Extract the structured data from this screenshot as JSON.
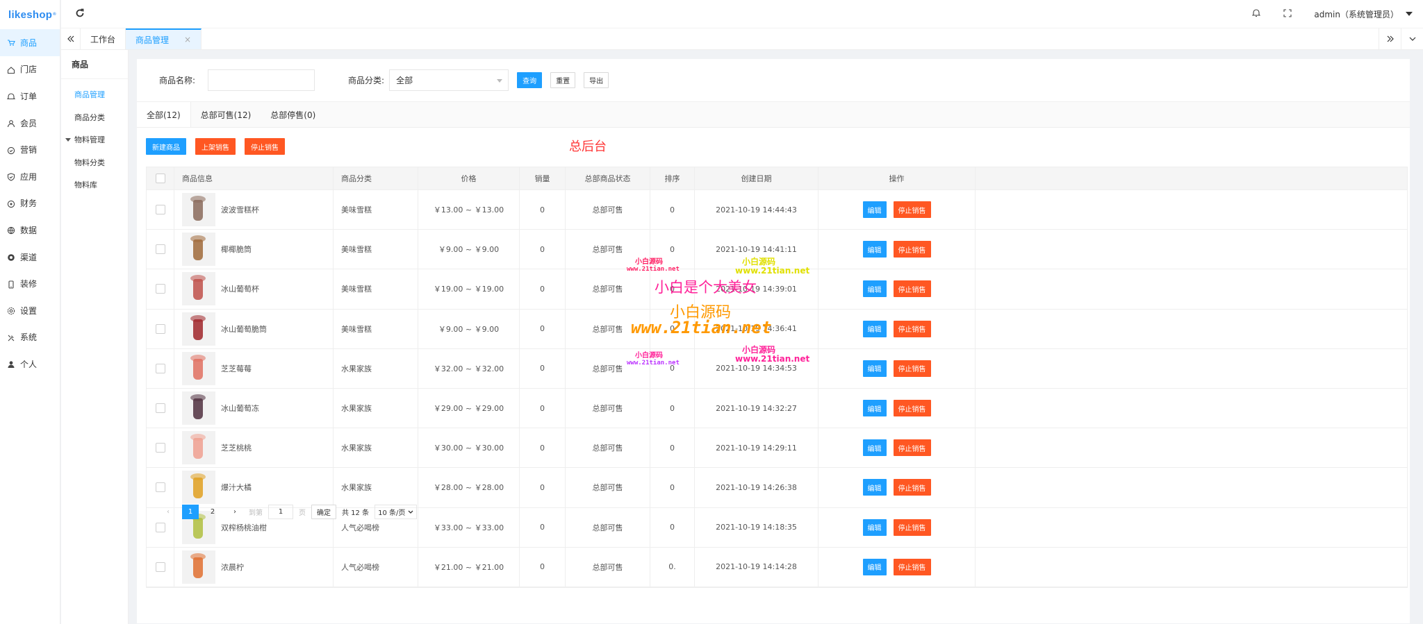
{
  "brand": {
    "logo_text": "likeshop",
    "logo_mark": "®",
    "color": "#2d8cf0"
  },
  "sidebar": {
    "items": [
      {
        "label": "商品",
        "icon": "cart-icon",
        "active": true
      },
      {
        "label": "门店",
        "icon": "home-icon"
      },
      {
        "label": "订单",
        "icon": "bell-icon"
      },
      {
        "label": "会员",
        "icon": "user-icon"
      },
      {
        "label": "营销",
        "icon": "heart-icon"
      },
      {
        "label": "应用",
        "icon": "shield-icon"
      },
      {
        "label": "财务",
        "icon": "coin-icon"
      },
      {
        "label": "数据",
        "icon": "globe-icon"
      },
      {
        "label": "渠道",
        "icon": "channel-icon"
      },
      {
        "label": "装修",
        "icon": "mobile-icon"
      },
      {
        "label": "设置",
        "icon": "gear-icon"
      },
      {
        "label": "系统",
        "icon": "tools-icon"
      },
      {
        "label": "个人",
        "icon": "person-icon"
      }
    ]
  },
  "topbar": {
    "user": "admin（系统管理员）"
  },
  "tabs": [
    {
      "label": "工作台"
    },
    {
      "label": "商品管理",
      "close": "×"
    }
  ],
  "subnav": {
    "title": "商品",
    "items": [
      {
        "label": "商品管理",
        "active": true
      },
      {
        "label": "商品分类"
      },
      {
        "label": "物料管理",
        "group": true
      },
      {
        "label": "物料分类"
      },
      {
        "label": "物料库"
      }
    ]
  },
  "filter": {
    "name_label": "商品名称:",
    "name_value": "",
    "category_label": "商品分类:",
    "category_value": "全部",
    "query": "查询",
    "reset": "重置",
    "export": "导出"
  },
  "subtabs": [
    {
      "label": "全部(12)"
    },
    {
      "label": "总部可售(12)"
    },
    {
      "label": "总部停售(0)"
    }
  ],
  "actions": {
    "new": "新建商品",
    "on_sale": "上架销售",
    "stop": "停止销售"
  },
  "watermark_title": "总后台",
  "table": {
    "headers": [
      "商品信息",
      "商品分类",
      "价格",
      "销量",
      "总部商品状态",
      "排序",
      "创建日期",
      "操作"
    ],
    "edit_label": "编辑",
    "stop_label": "停止销售",
    "rows": [
      {
        "name": "波波雪糕杯",
        "category": "美味雪糕",
        "price": "￥13.00 ~ ￥13.00",
        "sales": "0",
        "status": "总部可售",
        "sort": "0",
        "date": "2021-10-19 14:44:43",
        "color": "#8a6a5a"
      },
      {
        "name": "椰椰脆筒",
        "category": "美味雪糕",
        "price": "￥9.00 ~ ￥9.00",
        "sales": "0",
        "status": "总部可售",
        "sort": "0",
        "date": "2021-10-19 14:41:11",
        "color": "#a06a3a"
      },
      {
        "name": "冰山葡萄杯",
        "category": "美味雪糕",
        "price": "￥19.00 ~ ￥19.00",
        "sales": "0",
        "status": "总部可售",
        "sort": "0",
        "date": "2021-10-19 14:39:01",
        "color": "#c0504a"
      },
      {
        "name": "冰山葡萄脆筒",
        "category": "美味雪糕",
        "price": "￥9.00 ~ ￥9.00",
        "sales": "0",
        "status": "总部可售",
        "sort": "0",
        "date": "2021-10-19 14:36:41",
        "color": "#a0262a"
      },
      {
        "name": "芝芝莓莓",
        "category": "水果家族",
        "price": "￥32.00 ~ ￥32.00",
        "sales": "0",
        "status": "总部可售",
        "sort": "0",
        "date": "2021-10-19 14:34:53",
        "color": "#e07060"
      },
      {
        "name": "冰山葡萄冻",
        "category": "水果家族",
        "price": "￥29.00 ~ ￥29.00",
        "sales": "0",
        "status": "总部可售",
        "sort": "0",
        "date": "2021-10-19 14:32:27",
        "color": "#503040"
      },
      {
        "name": "芝芝桃桃",
        "category": "水果家族",
        "price": "￥30.00 ~ ￥30.00",
        "sales": "0",
        "status": "总部可售",
        "sort": "0",
        "date": "2021-10-19 14:29:11",
        "color": "#f0a090"
      },
      {
        "name": "爆汁大橘",
        "category": "水果家族",
        "price": "￥28.00 ~ ￥28.00",
        "sales": "0",
        "status": "总部可售",
        "sort": "0",
        "date": "2021-10-19 14:26:38",
        "color": "#e0a020"
      },
      {
        "name": "双榨杨桃油柑",
        "category": "人气必喝榜",
        "price": "￥33.00 ~ ￥33.00",
        "sales": "0",
        "status": "总部可售",
        "sort": "0",
        "date": "2021-10-19 14:18:35",
        "color": "#b0c040"
      },
      {
        "name": "浓晨柠",
        "category": "人气必喝榜",
        "price": "￥21.00 ~ ￥21.00",
        "sales": "0",
        "status": "总部可售",
        "sort": "0.",
        "date": "2021-10-19 14:14:28",
        "color": "#e07030"
      }
    ]
  },
  "pager": {
    "prev": "‹",
    "p1": "1",
    "p2": "2",
    "next": "›",
    "goto": "到第",
    "page_input": "1",
    "page_unit": "页",
    "confirm": "确定",
    "total": "共 12 条",
    "per_page": "10 条/页"
  },
  "watermarks": {
    "w1": "小白源码",
    "w2": "www.21tian.net",
    "w3": "小白源码",
    "w4": "www.21tian.net",
    "w5": "小白是个大美女",
    "w6": "小白源码",
    "w7": "www.21tian.net",
    "w8": "小白源码",
    "w9": "www.21tian.net",
    "w10": "小白源码",
    "w11": "www.21tian.net"
  }
}
